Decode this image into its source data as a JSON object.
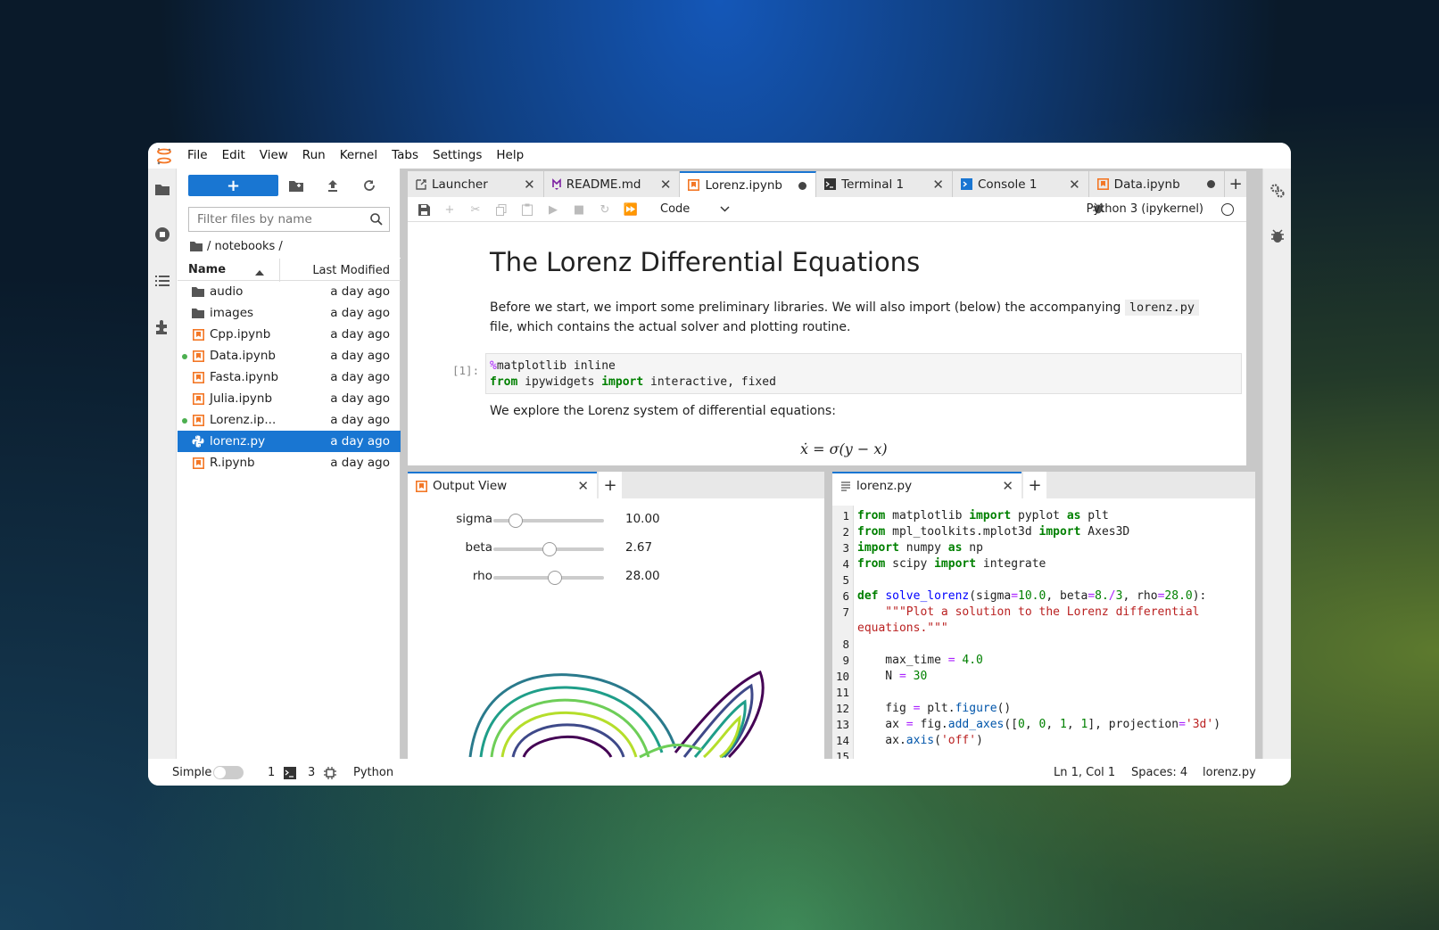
{
  "menubar": {
    "items": [
      "File",
      "Edit",
      "View",
      "Run",
      "Kernel",
      "Tabs",
      "Settings",
      "Help"
    ]
  },
  "filebrowser": {
    "new_label": "+",
    "filter_placeholder": "Filter files by name",
    "breadcrumb": "/ notebooks /",
    "col_name": "Name",
    "col_modified": "Last Modified",
    "files": [
      {
        "name": "audio",
        "modified": "a day ago",
        "icon": "folder-icon",
        "running": false
      },
      {
        "name": "images",
        "modified": "a day ago",
        "icon": "folder-icon",
        "running": false
      },
      {
        "name": "Cpp.ipynb",
        "modified": "a day ago",
        "icon": "notebook-icon",
        "running": false
      },
      {
        "name": "Data.ipynb",
        "modified": "a day ago",
        "icon": "notebook-icon",
        "running": true
      },
      {
        "name": "Fasta.ipynb",
        "modified": "a day ago",
        "icon": "notebook-icon",
        "running": false
      },
      {
        "name": "Julia.ipynb",
        "modified": "a day ago",
        "icon": "notebook-icon",
        "running": false
      },
      {
        "name": "Lorenz.ip...",
        "modified": "a day ago",
        "icon": "notebook-icon",
        "running": true
      },
      {
        "name": "lorenz.py",
        "modified": "a day ago",
        "icon": "python-icon",
        "running": false,
        "selected": true
      },
      {
        "name": "R.ipynb",
        "modified": "a day ago",
        "icon": "notebook-icon",
        "running": false
      }
    ]
  },
  "tabs": [
    {
      "label": "Launcher",
      "icon": "launcher-icon"
    },
    {
      "label": "README.md",
      "icon": "markdown-icon"
    },
    {
      "label": "Lorenz.ipynb",
      "icon": "notebook-icon",
      "active": true,
      "dirty": true
    },
    {
      "label": "Terminal 1",
      "icon": "terminal-icon"
    },
    {
      "label": "Console 1",
      "icon": "console-icon"
    },
    {
      "label": "Data.ipynb",
      "icon": "notebook-icon",
      "dirty": true
    }
  ],
  "notebook": {
    "cell_type": "Code",
    "kernel": "Python 3 (ipykernel)",
    "title": "The Lorenz Differential Equations",
    "intro_before": "Before we start, we import some preliminary libraries. We will also import (below) the accompanying",
    "intro_code": "lorenz.py",
    "intro_after": "file, which contains the actual solver and plotting routine.",
    "prompt": "[1]:",
    "explore": "We explore the Lorenz system of differential equations:",
    "equation": "ẋ = σ(y − x)"
  },
  "output_view": {
    "tab_label": "Output View",
    "sliders": [
      {
        "label": "sigma",
        "value": "10.00",
        "fraction": 0.2
      },
      {
        "label": "beta",
        "value": "2.67",
        "fraction": 0.5
      },
      {
        "label": "rho",
        "value": "28.00",
        "fraction": 0.56
      }
    ]
  },
  "editor": {
    "tab_label": "lorenz.py"
  },
  "statusbar": {
    "simple": "Simple",
    "terminals": "1",
    "kernels": "3",
    "language": "Python",
    "position": "Ln 1, Col 1",
    "spaces": "Spaces: 4",
    "filename": "lorenz.py"
  },
  "colors": {
    "accent": "#1976d2",
    "running_dot": "#4caf50",
    "notebook_icon": "#f37726"
  }
}
